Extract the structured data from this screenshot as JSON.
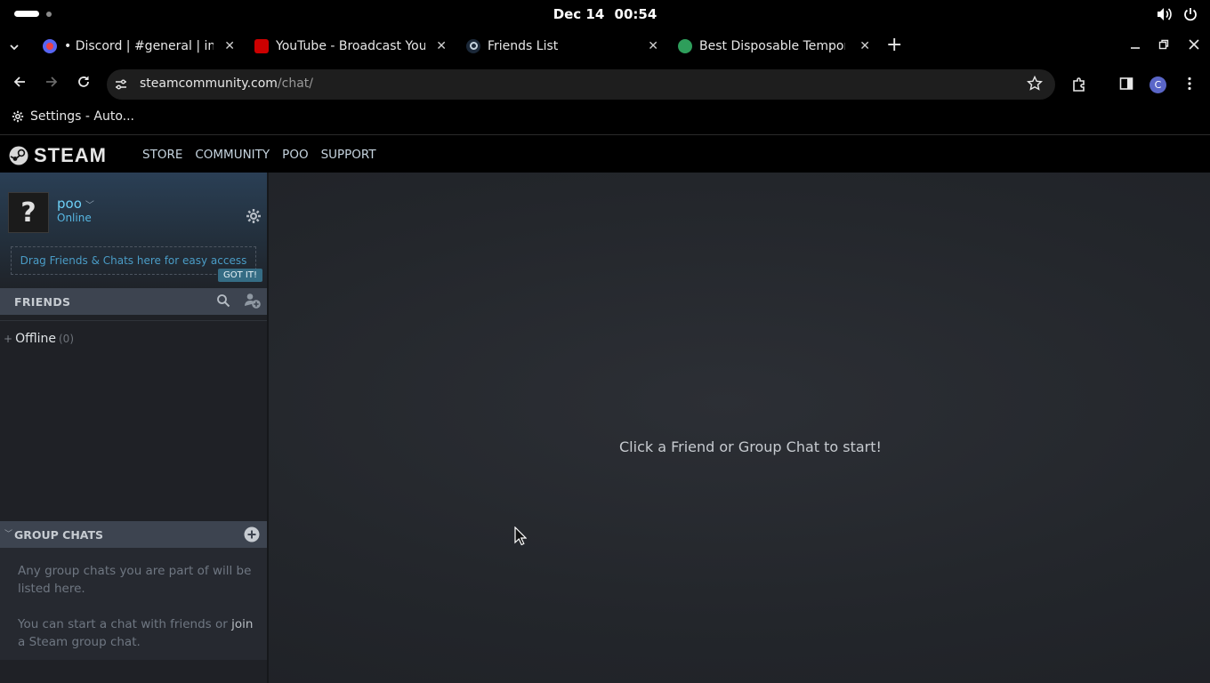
{
  "system": {
    "date": "Dec 14",
    "time": "00:54"
  },
  "browser": {
    "tabs": [
      {
        "title": "• Discord | #general | inf",
        "active": false
      },
      {
        "title": "YouTube - Broadcast You",
        "active": false
      },
      {
        "title": "Friends List",
        "active": true
      },
      {
        "title": "Best Disposable Tempor",
        "active": false
      }
    ],
    "address": {
      "host": "steamcommunity.com",
      "path": "/chat/"
    },
    "profile_initial": "C",
    "bookmark": "Settings - Auto..."
  },
  "steam": {
    "logo_text": "STEAM",
    "nav": [
      "STORE",
      "COMMUNITY",
      "POO",
      "SUPPORT"
    ],
    "user": {
      "name": "poo",
      "status": "Online",
      "avatar_glyph": "?"
    },
    "dropzone_text": "Drag Friends & Chats here for easy access",
    "got_it": "GOT IT!",
    "friends_label": "FRIENDS",
    "offline_label": "Offline",
    "offline_count": "(0)",
    "group_chats_label": "GROUP CHATS",
    "group_info_1": "Any group chats you are part of will be listed here.",
    "group_info_2_prefix": "You can start a chat with friends or ",
    "group_info_2_link": "join",
    "group_info_2_suffix": " a Steam group chat.",
    "start_message": "Click a Friend or Group Chat to start!"
  },
  "colors": {
    "steam_blue": "#6dcff6",
    "panel_bg": "#1f2126",
    "header_bar": "#3d4450"
  }
}
